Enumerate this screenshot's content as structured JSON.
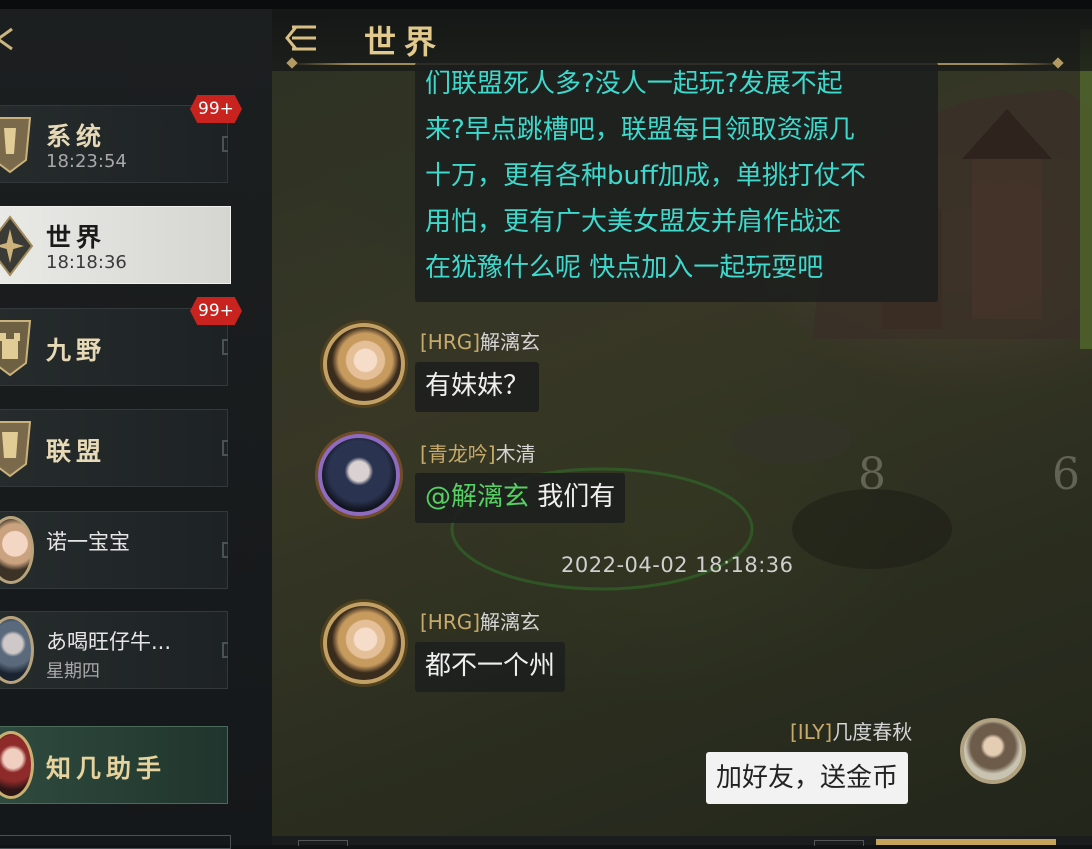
{
  "sidebar": {
    "channels": [
      {
        "title": "系统",
        "time": "18:23:54",
        "badge": "99+"
      },
      {
        "title": "世界",
        "time": "18:18:36",
        "active": true
      },
      {
        "title": "九野",
        "time": "",
        "badge": "99+"
      },
      {
        "title": "联盟",
        "time": ""
      },
      {
        "title": "诺一宝宝",
        "time": ""
      },
      {
        "title": "あ喝旺仔牛...",
        "time": "星期四"
      },
      {
        "title": "知几助手",
        "time": ""
      }
    ]
  },
  "header": {
    "title": "世界"
  },
  "map": {
    "num1": "8",
    "num2": "6"
  },
  "messages": {
    "system": {
      "lines": [
        "们联盟死人多?没人一起玩?发展不起",
        "来?早点跳槽吧，联盟每日领取资源几",
        "十万，更有各种buff加成，单挑打仗不",
        "用怕，更有广大美女盟友并肩作战还",
        "在犹豫什么呢 快点加入一起玩耍吧"
      ]
    },
    "m1": {
      "tag": "[HRG]",
      "name": "解漓玄",
      "text": "有妹妹？"
    },
    "m2": {
      "tag": "[青龙吟]",
      "name": "木清",
      "mention": "@解漓玄",
      "text": " 我们有"
    },
    "timestamp": "2022-04-02 18:18:36",
    "m3": {
      "tag": "[HRG]",
      "name": "解漓玄",
      "text": "都不一个州"
    },
    "m4": {
      "tag": "[ILY]",
      "name": "几度春秋",
      "text": "加好友，送金币"
    }
  },
  "colors": {
    "accent_gold": "#e2c98e",
    "system_text": "#3fd8cc",
    "mention": "#55d062",
    "badge": "#c8231e"
  }
}
